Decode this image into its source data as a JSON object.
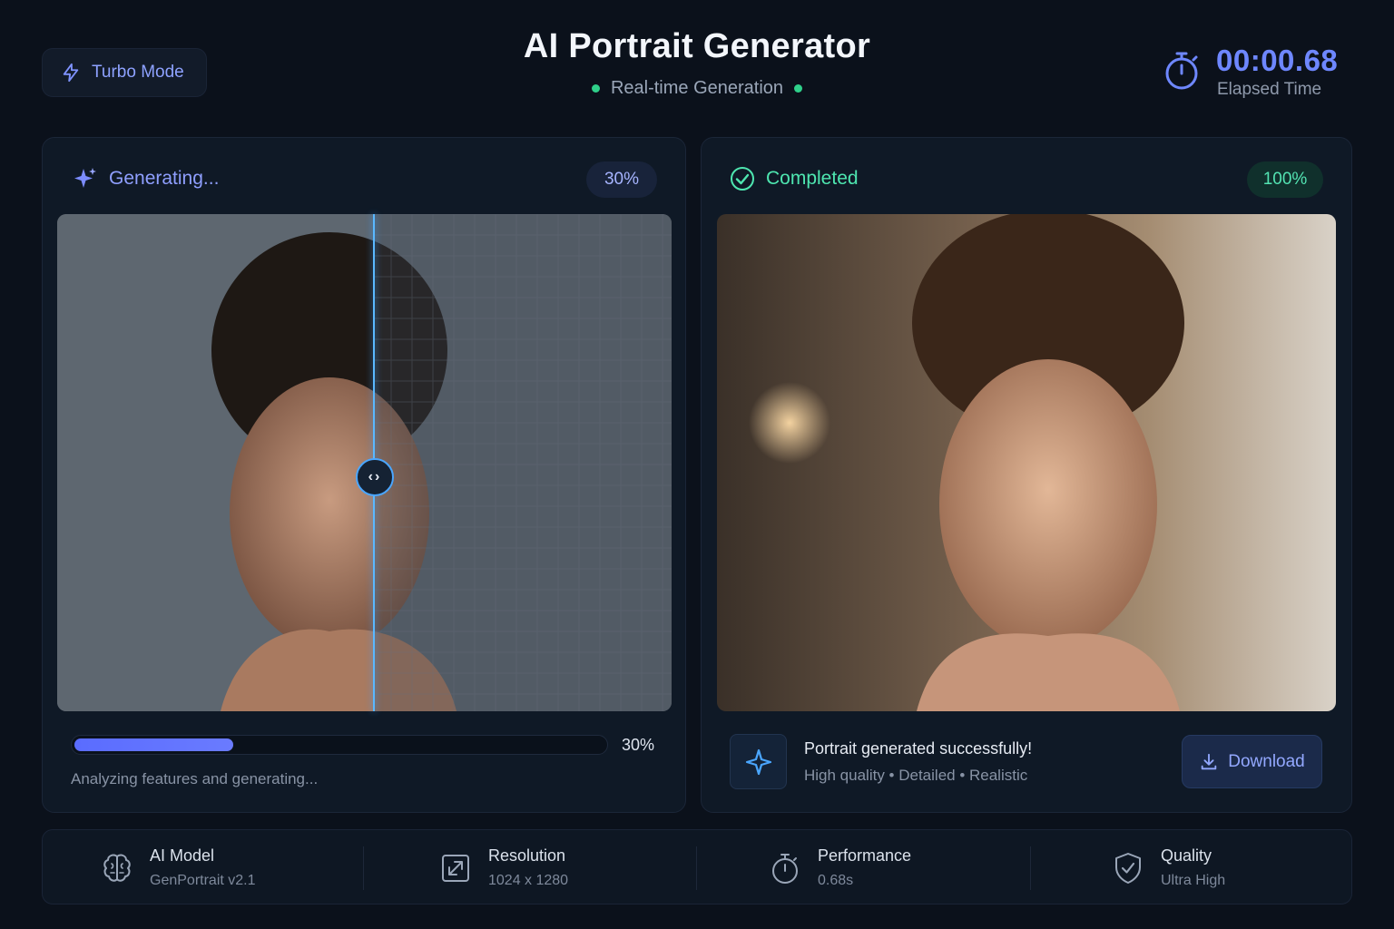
{
  "header": {
    "turbo_label": "Turbo Mode",
    "title": "AI Portrait Generator",
    "subtitle": "Real-time Generation",
    "timer_value": "00:00.68",
    "timer_label": "Elapsed Time"
  },
  "generating_panel": {
    "status": "Generating...",
    "badge": "30%",
    "progress_fraction": 0.3,
    "progress_label": "30%",
    "note": "Analyzing features and generating..."
  },
  "completed_panel": {
    "status": "Completed",
    "badge": "100%",
    "success_title": "Portrait generated successfully!",
    "success_sub": "High quality • Detailed • Realistic",
    "download_label": "Download"
  },
  "stats": [
    {
      "icon": "brain-icon",
      "label": "AI Model",
      "value": "GenPortrait v2.1"
    },
    {
      "icon": "resize-icon",
      "label": "Resolution",
      "value": "1024 x 1280"
    },
    {
      "icon": "stopwatch-icon",
      "label": "Performance",
      "value": "0.68s"
    },
    {
      "icon": "shield-check-icon",
      "label": "Quality",
      "value": "Ultra High"
    }
  ],
  "colors": {
    "accent": "#6e87ff",
    "success": "#4ee6b0",
    "background": "#0b111b"
  }
}
